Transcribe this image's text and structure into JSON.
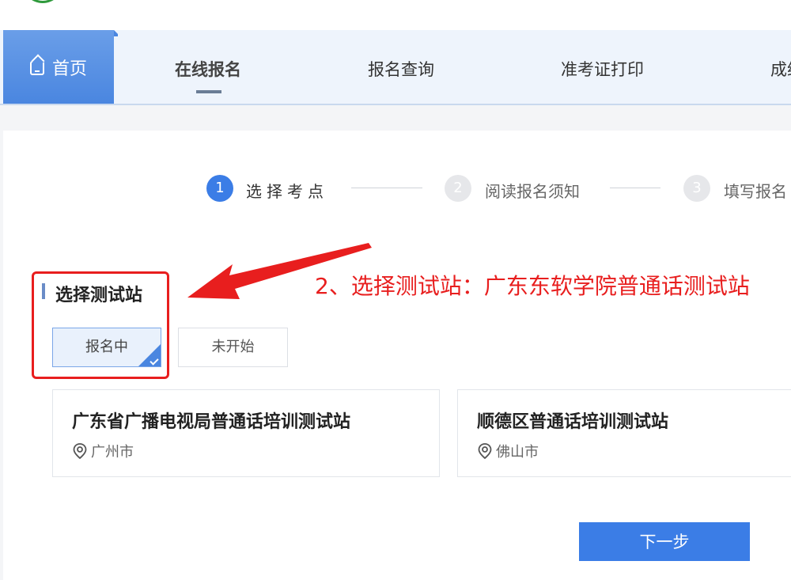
{
  "nav": {
    "home_label": "首页",
    "items": [
      {
        "label": "在线报名",
        "active": true
      },
      {
        "label": "报名查询",
        "active": false
      },
      {
        "label": "准考证打印",
        "active": false
      },
      {
        "label": "成绩",
        "active": false
      }
    ]
  },
  "steps": [
    {
      "number": "1",
      "label": "选择考点",
      "active": true
    },
    {
      "number": "2",
      "label": "阅读报名须知",
      "active": false
    },
    {
      "number": "3",
      "label": "填写报名",
      "active": false
    }
  ],
  "section": {
    "title": "选择测试站"
  },
  "filters": [
    {
      "label": "报名中",
      "selected": true
    },
    {
      "label": "未开始",
      "selected": false
    }
  ],
  "stations": [
    {
      "name": "广东省广播电视局普通话培训测试站",
      "city": "广州市"
    },
    {
      "name": "顺德区普通话培训测试站",
      "city": "佛山市"
    }
  ],
  "annotation": {
    "text": "2、选择测试站：广东东软学院普通话测试站",
    "color": "#e81e1e"
  },
  "next_button": {
    "label": "下一步"
  },
  "colors": {
    "accent": "#3b7de6",
    "nav_bg": "#eef4fc",
    "annotation": "#e81e1e"
  }
}
